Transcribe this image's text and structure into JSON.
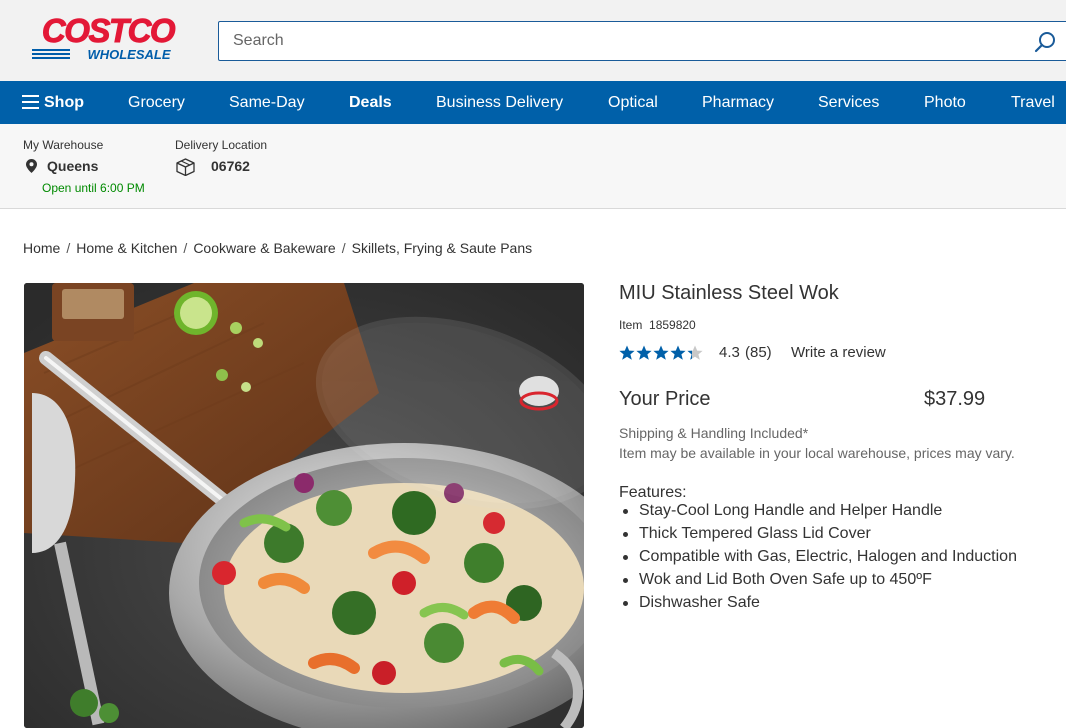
{
  "header": {
    "logo_top": "COSTCO",
    "logo_bottom": "WHOLESALE",
    "search_placeholder": "Search"
  },
  "nav": {
    "items": [
      {
        "label": "Shop"
      },
      {
        "label": "Grocery"
      },
      {
        "label": "Same-Day"
      },
      {
        "label": "Deals"
      },
      {
        "label": "Business Delivery"
      },
      {
        "label": "Optical"
      },
      {
        "label": "Pharmacy"
      },
      {
        "label": "Services"
      },
      {
        "label": "Photo"
      },
      {
        "label": "Travel"
      }
    ]
  },
  "location": {
    "warehouse_label": "My Warehouse",
    "warehouse_name": "Queens",
    "warehouse_hours": "Open until 6:00 PM",
    "delivery_label": "Delivery Location",
    "delivery_zip": "06762"
  },
  "breadcrumb": [
    "Home",
    "Home & Kitchen",
    "Cookware & Bakeware",
    "Skillets, Frying & Saute Pans"
  ],
  "product": {
    "title": "MIU Stainless Steel Wok",
    "item_label": "Item",
    "item_number": "1859820",
    "rating": "4.3",
    "rating_stars": 4.3,
    "review_count": "(85)",
    "write_review": "Write a review",
    "price_label": "Your Price",
    "price": "$37.99",
    "shipping": "Shipping & Handling Included*",
    "availability": "Item may be available in your local warehouse, prices may vary.",
    "features_label": "Features:",
    "features": [
      "Stay-Cool Long Handle and Helper Handle",
      "Thick Tempered Glass Lid Cover",
      "Compatible with Gas, Electric, Halogen and Induction",
      "Wok and Lid Both Oven Safe up to 450ºF",
      "Dishwasher Safe"
    ]
  },
  "colors": {
    "brand_red": "#e31837",
    "brand_blue": "#005daa",
    "nav_blue": "#0060a9",
    "star_blue": "#0060a9",
    "open_green": "#008a00"
  },
  "icons": {
    "search": "search-icon",
    "menu": "hamburger-icon",
    "location": "map-pin-icon",
    "delivery": "box-icon",
    "star": "star-icon"
  }
}
